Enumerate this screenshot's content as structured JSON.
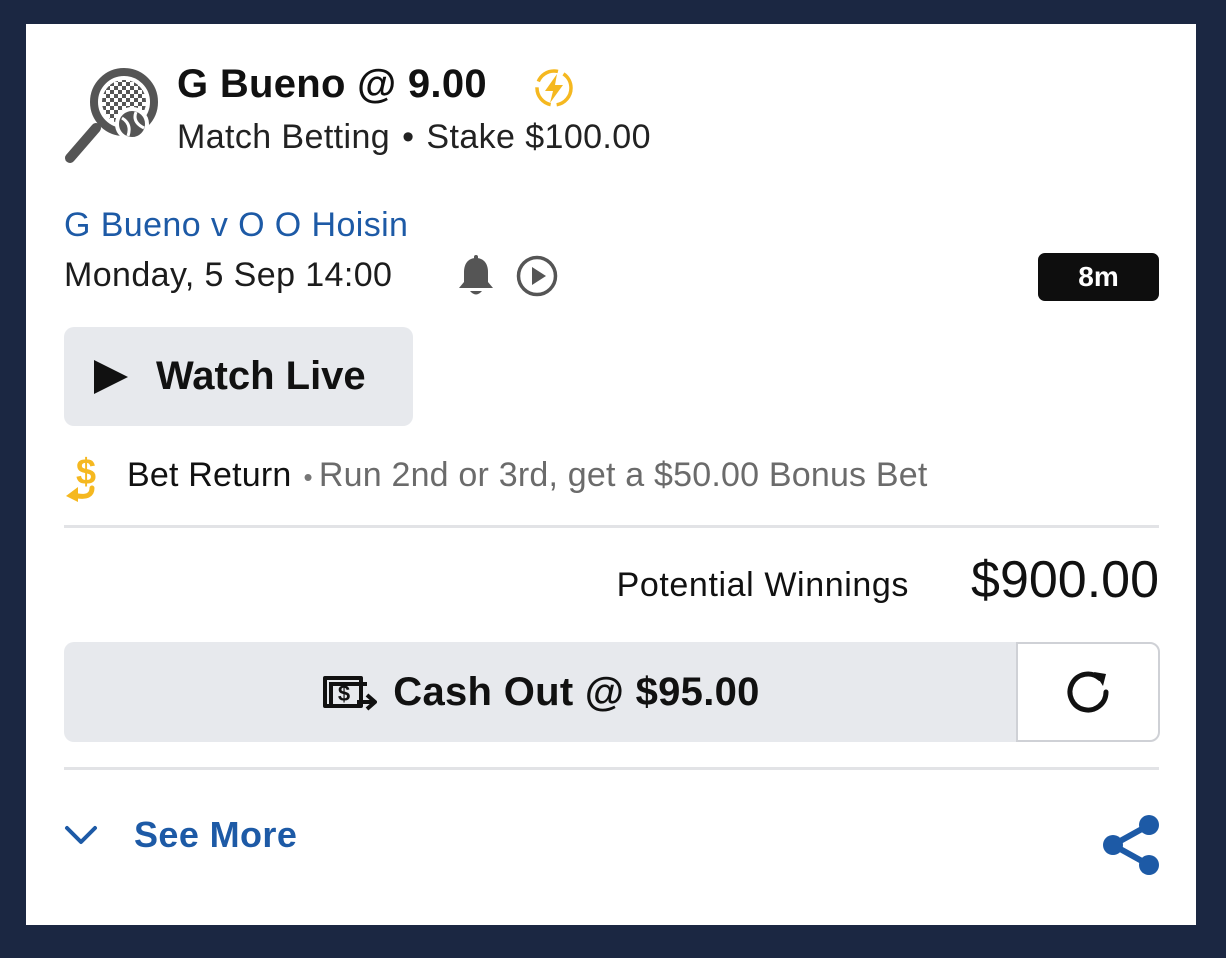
{
  "bet": {
    "title": "G Bueno @ 9.00",
    "market": "Match Betting",
    "stake": "Stake $100.00",
    "sport_icon": "tennis-racket-icon",
    "boost_icon": "lightning-bolt-icon"
  },
  "event": {
    "name": "G Bueno v O O Hoisin",
    "datetime": "Monday, 5 Sep 14:00",
    "countdown": "8m"
  },
  "watch_live": {
    "label": "Watch Live"
  },
  "promo": {
    "name": "Bet Return",
    "description": "Run 2nd or 3rd, get a $50.00 Bonus Bet"
  },
  "winnings": {
    "label": "Potential Winnings",
    "value": "$900.00"
  },
  "cash_out": {
    "label": "Cash Out @ $95.00"
  },
  "footer": {
    "see_more_label": "See More"
  },
  "colors": {
    "background": "#1b2742",
    "card": "#ffffff",
    "link_blue": "#1d5aa6",
    "boost_yellow": "#f5b820",
    "button_gray": "#e7e9ed",
    "badge_black": "#0e0e0e"
  }
}
